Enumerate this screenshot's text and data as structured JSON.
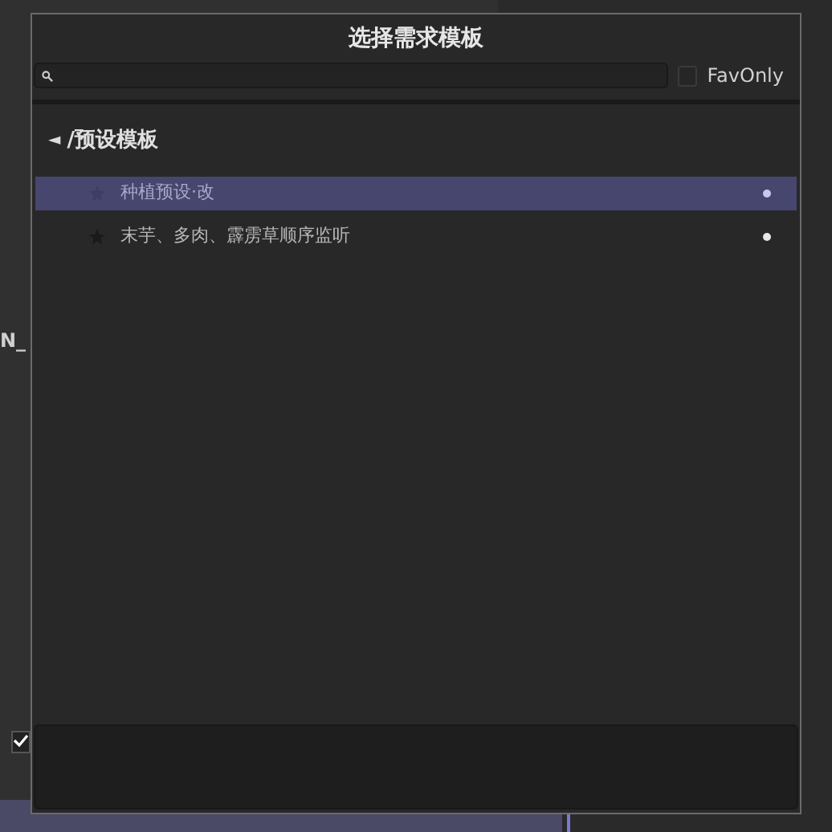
{
  "background": {
    "label_fragment": "N_",
    "checkbox": {
      "checked": true
    }
  },
  "dialog": {
    "title": "选择需求模板",
    "fav_only": {
      "label": "FavOnly",
      "checked": false
    },
    "breadcrumb": {
      "back": "◄",
      "path": "/预设模板"
    },
    "items": [
      {
        "label": "种植预设·改",
        "selected": true
      },
      {
        "label": "末芋、多肉、霹雳草顺序监听",
        "selected": false
      }
    ]
  }
}
